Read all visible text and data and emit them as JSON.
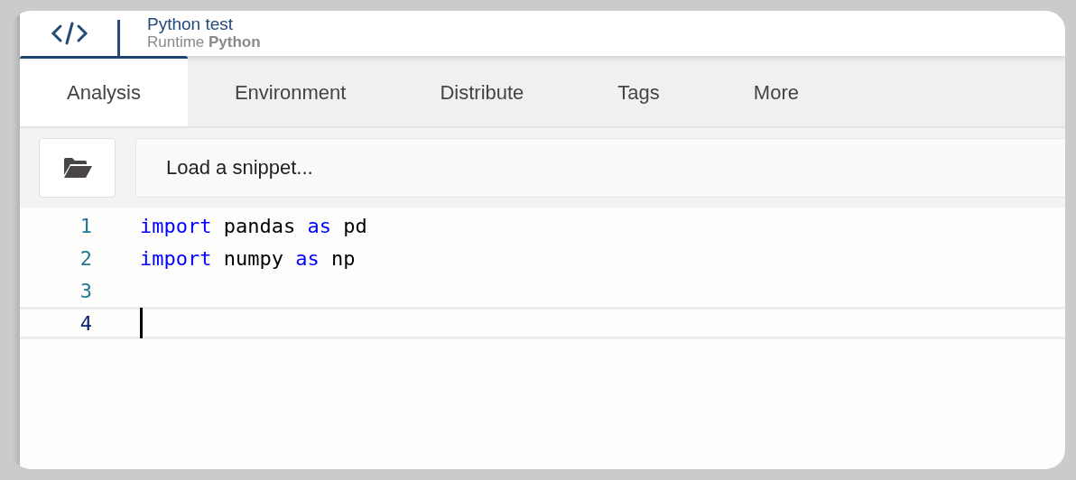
{
  "header": {
    "title": "Python test",
    "subtitle": "Runtime **Python**"
  },
  "tabs": [
    {
      "label": "Analysis",
      "selected": true
    },
    {
      "label": "Environment",
      "selected": false
    },
    {
      "label": "Distribute",
      "selected": false
    },
    {
      "label": "Tags",
      "selected": false
    },
    {
      "label": "More",
      "selected": false
    }
  ],
  "snippet": {
    "placeholder": "Load a snippet..."
  },
  "editor": {
    "lines": [
      {
        "number": "1",
        "active": false,
        "tokens": [
          {
            "text": "import",
            "kind": "keyword"
          },
          {
            "text": " pandas ",
            "kind": "plain"
          },
          {
            "text": "as",
            "kind": "keyword"
          },
          {
            "text": " pd",
            "kind": "plain"
          }
        ]
      },
      {
        "number": "2",
        "active": false,
        "tokens": [
          {
            "text": "import",
            "kind": "keyword"
          },
          {
            "text": " numpy ",
            "kind": "plain"
          },
          {
            "text": "as",
            "kind": "keyword"
          },
          {
            "text": " np",
            "kind": "plain"
          }
        ]
      },
      {
        "number": "3",
        "active": false
      },
      {
        "number": "4",
        "active": true
      }
    ]
  }
}
